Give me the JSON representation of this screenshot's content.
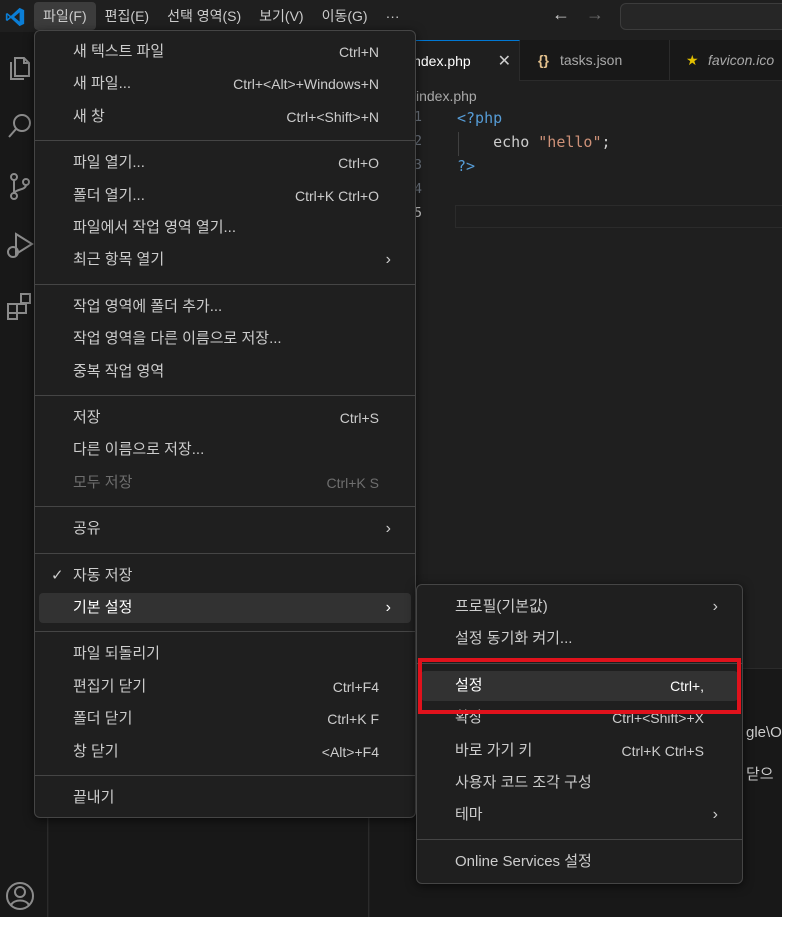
{
  "menubar": {
    "items": [
      "파일(F)",
      "편집(E)",
      "선택 영역(S)",
      "보기(V)",
      "이동(G)",
      "···"
    ],
    "active_index": 0
  },
  "navigation": {
    "back_icon": "arrow-left-icon",
    "forward_icon": "arrow-right-icon"
  },
  "activity_bar": {
    "icons": [
      "explorer-icon",
      "search-icon",
      "source-control-icon",
      "run-debug-icon",
      "extensions-icon",
      "account-icon"
    ]
  },
  "tabs": [
    {
      "label": "index.php",
      "active": true,
      "close": "✕"
    },
    {
      "label": "tasks.json",
      "prefix": "{}",
      "active": false
    },
    {
      "label": "favicon.ico",
      "prefix": "★",
      "active": false
    }
  ],
  "editor": {
    "breadcrumb": "index.php",
    "line_numbers": [
      "1",
      "2",
      "3",
      "4",
      "5"
    ],
    "lines": [
      [
        {
          "t": "<?php",
          "k": "tag"
        }
      ],
      [
        {
          "t": "    echo ",
          "k": "kw"
        },
        {
          "t": "\"hello\"",
          "k": "str"
        },
        {
          "t": ";",
          "k": "punc"
        }
      ],
      [
        {
          "t": "?>",
          "k": "tag"
        }
      ],
      [],
      []
    ]
  },
  "panel": {
    "texts": [
      "gle\\O",
      "닫으"
    ]
  },
  "file_menu": {
    "groups": [
      [
        {
          "label": "새 텍스트 파일",
          "shortcut": "Ctrl+N"
        },
        {
          "label": "새 파일...",
          "shortcut": "Ctrl+<Alt>+Windows+N"
        },
        {
          "label": "새 창",
          "shortcut": "Ctrl+<Shift>+N"
        }
      ],
      [
        {
          "label": "파일 열기...",
          "shortcut": "Ctrl+O"
        },
        {
          "label": "폴더 열기...",
          "shortcut": "Ctrl+K Ctrl+O"
        },
        {
          "label": "파일에서 작업 영역 열기...",
          "shortcut": ""
        },
        {
          "label": "최근 항목 열기",
          "shortcut": "",
          "submenu": true
        }
      ],
      [
        {
          "label": "작업 영역에 폴더 추가...",
          "shortcut": ""
        },
        {
          "label": "작업 영역을 다른 이름으로 저장...",
          "shortcut": ""
        },
        {
          "label": "중복 작업 영역",
          "shortcut": ""
        }
      ],
      [
        {
          "label": "저장",
          "shortcut": "Ctrl+S"
        },
        {
          "label": "다른 이름으로 저장...",
          "shortcut": ""
        },
        {
          "label": "모두 저장",
          "shortcut": "Ctrl+K S",
          "disabled": true
        }
      ],
      [
        {
          "label": "공유",
          "shortcut": "",
          "submenu": true
        }
      ],
      [
        {
          "label": "자동 저장",
          "shortcut": "",
          "checked": true
        },
        {
          "label": "기본 설정",
          "shortcut": "",
          "submenu": true,
          "highlighted": true
        }
      ],
      [
        {
          "label": "파일 되돌리기",
          "shortcut": ""
        },
        {
          "label": "편집기 닫기",
          "shortcut": "Ctrl+F4"
        },
        {
          "label": "폴더 닫기",
          "shortcut": "Ctrl+K F"
        },
        {
          "label": "창 닫기",
          "shortcut": "<Alt>+F4"
        }
      ],
      [
        {
          "label": "끝내기",
          "shortcut": ""
        }
      ]
    ]
  },
  "preferences_menu": {
    "groups": [
      [
        {
          "label": "프로필(기본값)",
          "shortcut": "",
          "submenu": true
        },
        {
          "label": "설정 동기화 켜기...",
          "shortcut": ""
        }
      ],
      [
        {
          "label": "설정",
          "shortcut": "Ctrl+,",
          "highlighted": true
        },
        {
          "label": "확장",
          "shortcut": "Ctrl+<Shift>+X"
        },
        {
          "label": "바로 가기 키",
          "shortcut": "Ctrl+K Ctrl+S"
        },
        {
          "label": "사용자 코드 조각 구성",
          "shortcut": ""
        },
        {
          "label": "테마",
          "shortcut": "",
          "submenu": true
        }
      ],
      [
        {
          "label": "Online Services 설정",
          "shortcut": ""
        }
      ]
    ]
  },
  "glyphs": {
    "chevron": "›",
    "check": "✓"
  },
  "colors": {
    "highlight_box": "#e0121c",
    "accent": "#0078d4"
  }
}
